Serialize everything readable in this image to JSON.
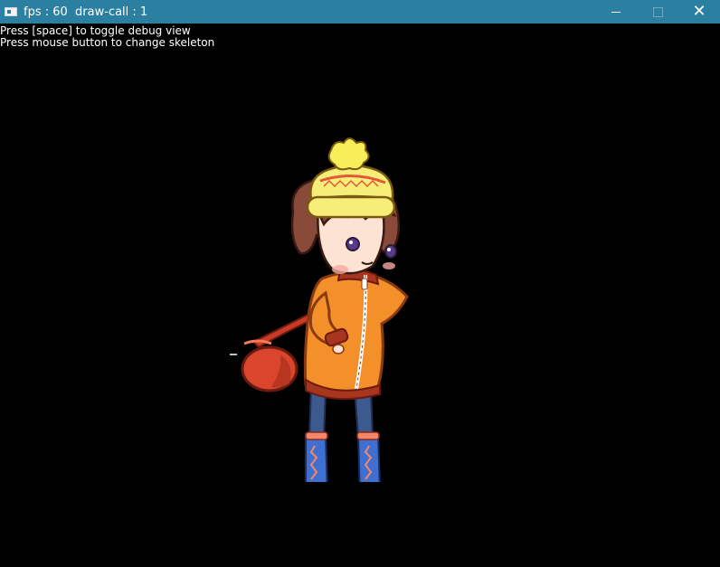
{
  "window": {
    "title": "fps : 60  draw-call : 1",
    "controls": {
      "minimize": "minimize-icon",
      "maximize": "maximize-icon",
      "close": "close-icon"
    }
  },
  "overlay": {
    "line1": "Press [space] to toggle debug view",
    "line2": "Press mouse button to change skeleton"
  },
  "colors": {
    "titlebar": "#2b7fa0",
    "background": "#000000",
    "coat": "#f4902a",
    "hat": "#f7ee7a",
    "hair": "#8a4a3a",
    "boots": "#3f6fd1",
    "bag": "#d9462c"
  }
}
